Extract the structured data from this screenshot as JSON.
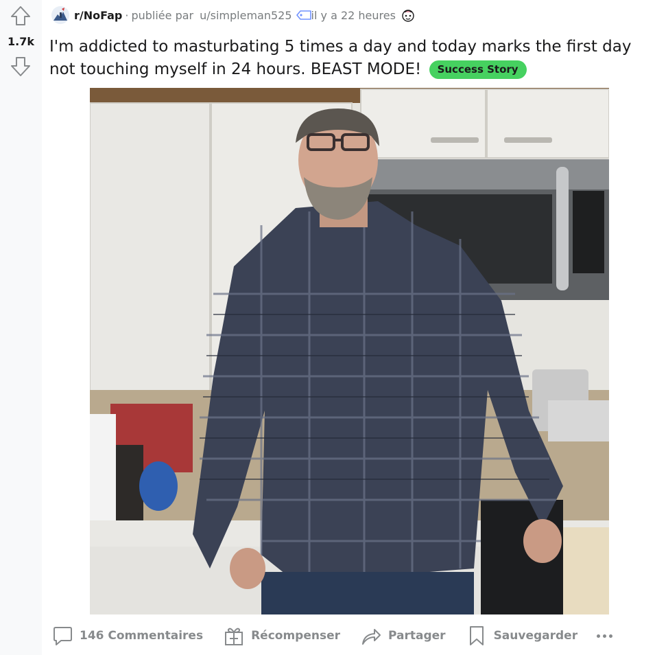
{
  "post": {
    "score": "1.7k",
    "subreddit": "r/NoFap",
    "separator": "·",
    "posted_by": "publiée par",
    "username": "u/simpleman525",
    "time_ago": "il y a 22 heures",
    "title": "I'm addicted to masturbating 5 times a day and today marks the first day not touching myself in 24 hours. BEAST MODE!",
    "flair": "Success Story",
    "flair_color": "#46d160"
  },
  "actions": {
    "comments": "146 Commentaires",
    "award": "Récompenser",
    "share": "Partager",
    "save": "Sauvegarder"
  },
  "icons": {
    "upvote": "arrow-up-icon",
    "downvote": "arrow-down-icon",
    "subreddit": "nofap-subreddit-icon",
    "tag": "tag-icon",
    "award": "award-icon",
    "comment": "comment-bubble-icon",
    "gift": "gift-icon",
    "share": "share-arrow-icon",
    "bookmark": "bookmark-icon",
    "more": "ellipsis-icon"
  }
}
